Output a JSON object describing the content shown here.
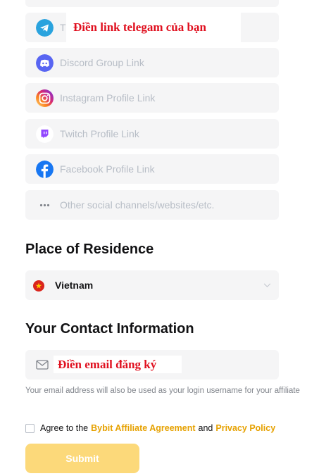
{
  "social": {
    "telegram": {
      "placeholder": "T",
      "overlay": "Điền link telegam của bạn",
      "icon": "telegram-icon"
    },
    "discord": {
      "placeholder": "Discord Group Link",
      "icon": "discord-icon"
    },
    "instagram": {
      "placeholder": "Instagram Profile Link",
      "icon": "instagram-icon"
    },
    "twitch": {
      "placeholder": "Twitch Profile Link",
      "icon": "twitch-icon"
    },
    "facebook": {
      "placeholder": "Facebook Profile Link",
      "icon": "facebook-icon"
    },
    "other": {
      "placeholder": "Other social channels/websites/etc.",
      "icon": "more-dots-icon"
    }
  },
  "residence": {
    "title": "Place of Residence",
    "selected": "Vietnam",
    "flag_icon": "vietnam-flag-icon"
  },
  "contact": {
    "title": "Your Contact Information",
    "email_overlay": "Điền email đăng ký",
    "email_icon": "envelope-icon",
    "note": "Your email address will also be used as your login username for your affiliate"
  },
  "agreement": {
    "prefix": "Agree to the",
    "link1": "Bybit Affiliate Agreement",
    "middle": "and",
    "link2": "Privacy Policy"
  },
  "submit_label": "Submit",
  "colors": {
    "field_bg": "#f5f5f6",
    "placeholder": "#b7bdc6",
    "accent_link": "#e6a100",
    "submit_bg": "#fcd97a",
    "overlay_red": "#e0101f"
  }
}
